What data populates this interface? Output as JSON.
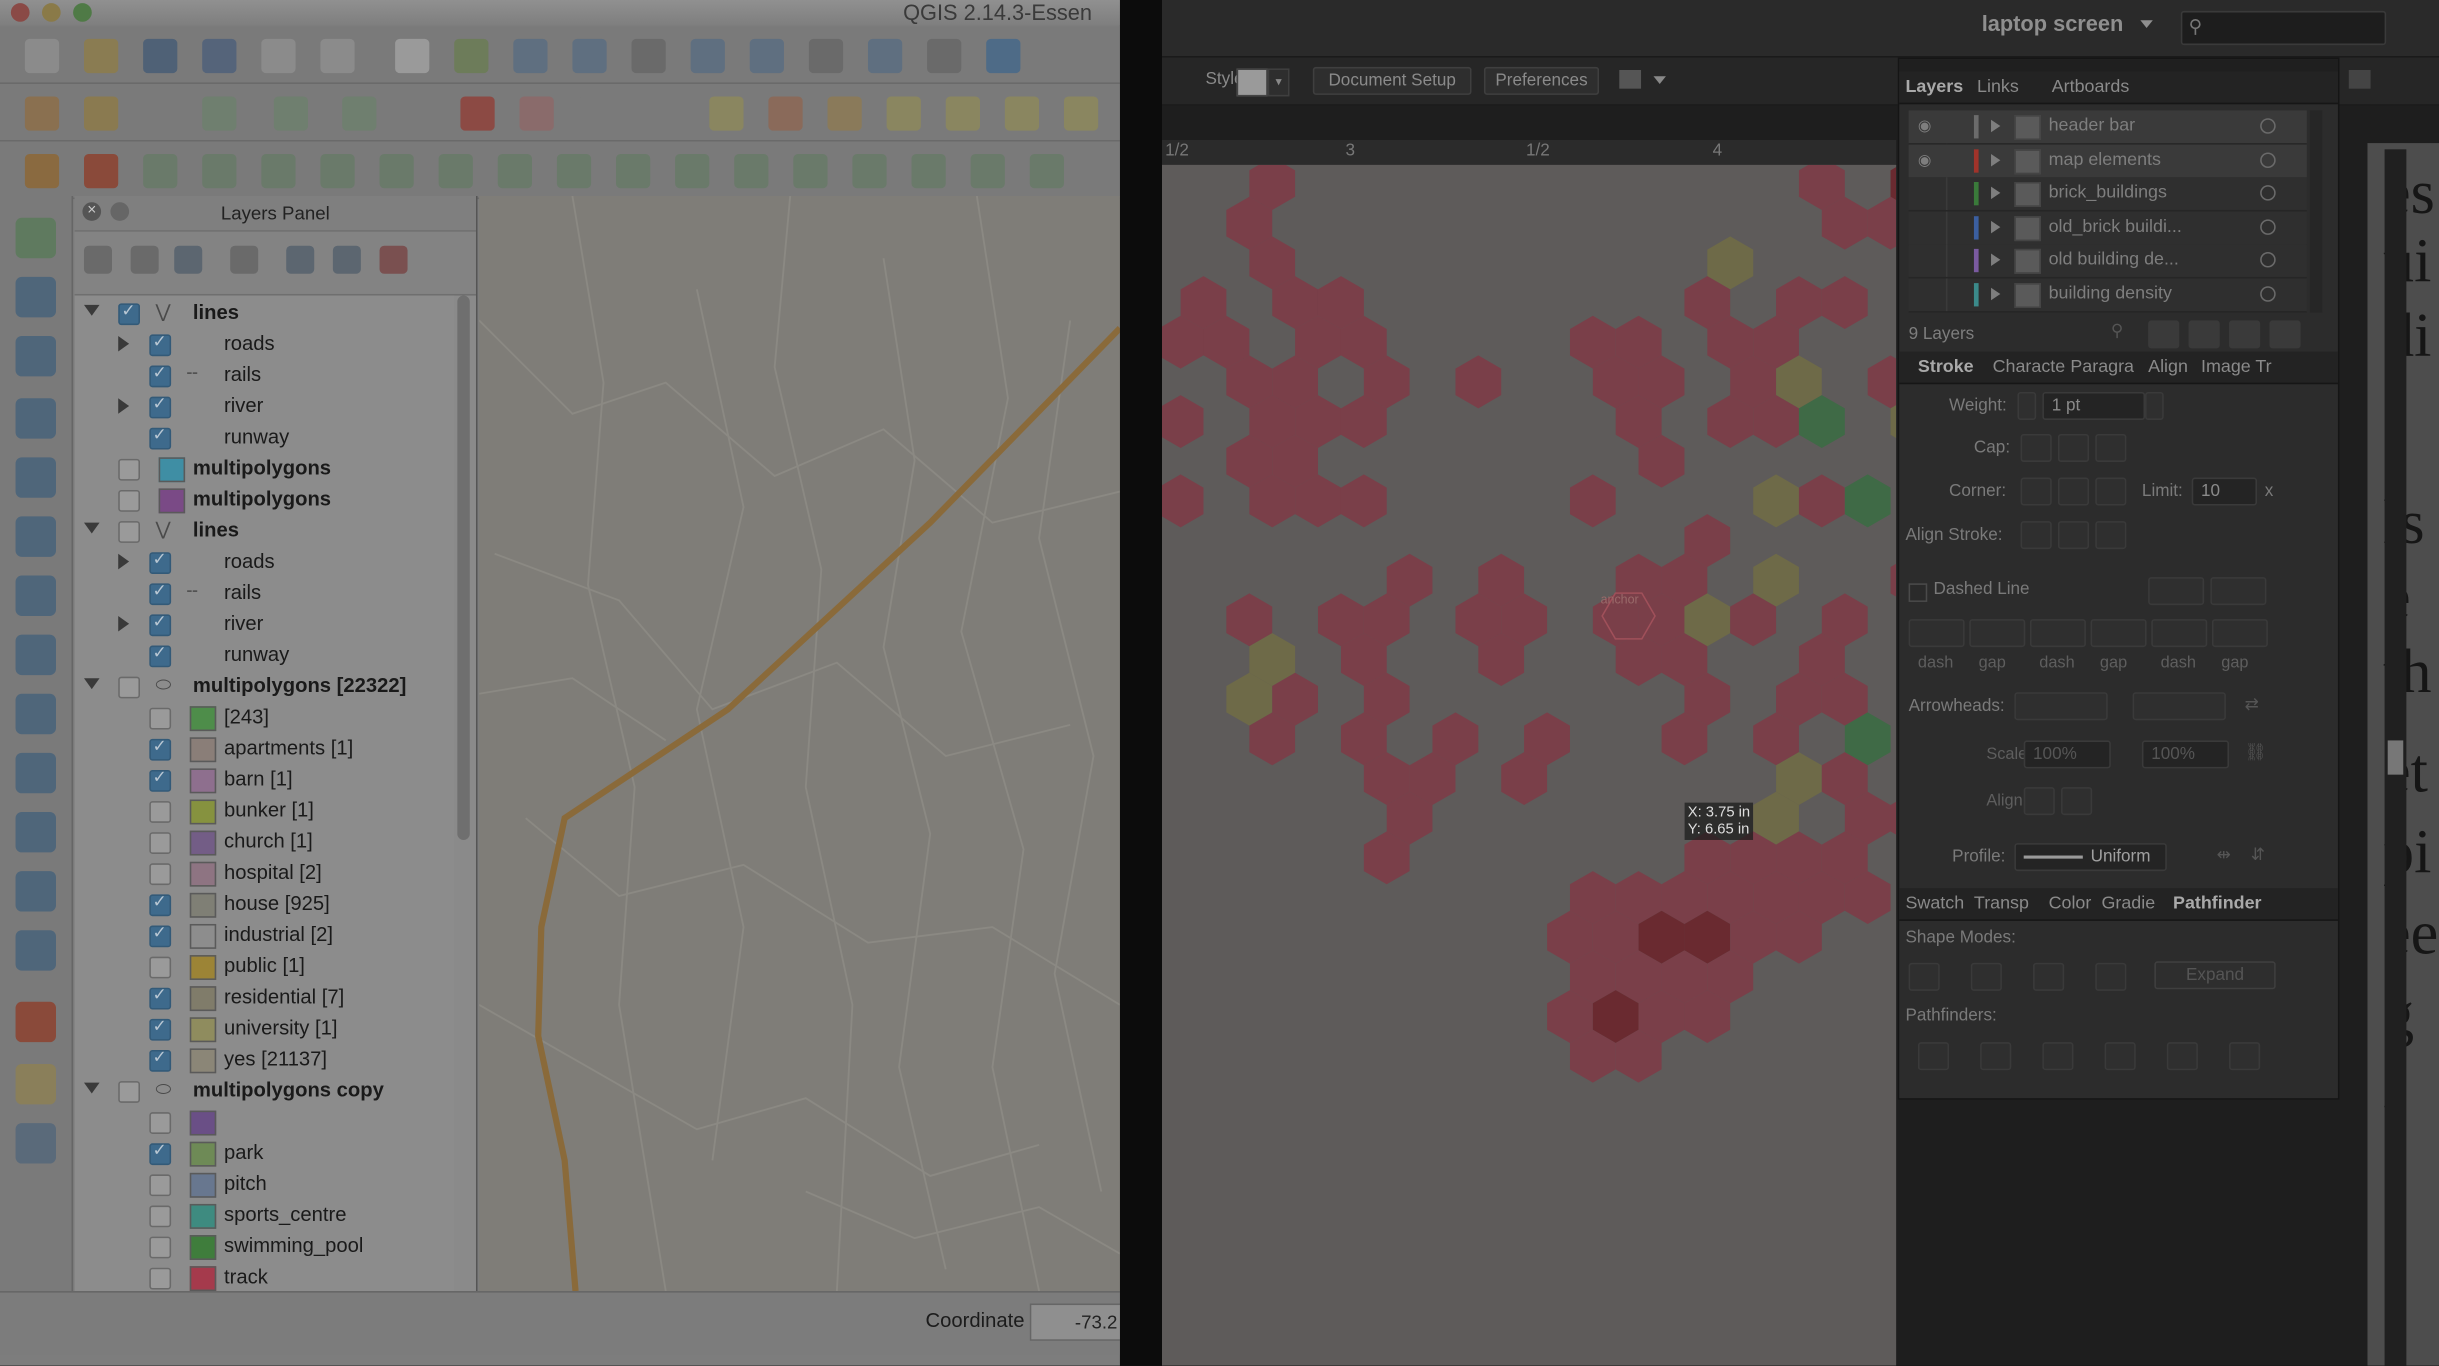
{
  "qgis": {
    "window_title": "QGIS 2.14.3-Essen",
    "layers_panel": {
      "title": "Layers Panel",
      "tree": [
        {
          "label": "lines",
          "bold": true,
          "checked": true,
          "expand": "down",
          "level": 0,
          "icon": "vector-line-icon"
        },
        {
          "label": "roads",
          "checked": true,
          "expand": "right",
          "level": 1
        },
        {
          "label": "rails",
          "checked": true,
          "level": 1,
          "icon": "dash-line-icon"
        },
        {
          "label": "river",
          "checked": true,
          "expand": "right",
          "level": 1
        },
        {
          "label": "runway",
          "checked": true,
          "level": 1
        },
        {
          "label": "multipolygons",
          "bold": true,
          "checked": false,
          "level": 0,
          "swatch": "#3f8ea4"
        },
        {
          "label": "multipolygons",
          "bold": true,
          "checked": false,
          "level": 0,
          "swatch": "#7a4a86"
        },
        {
          "label": "lines",
          "bold": true,
          "checked": false,
          "expand": "down",
          "level": 0,
          "icon": "vector-line-icon"
        },
        {
          "label": "roads",
          "checked": true,
          "expand": "right",
          "level": 1
        },
        {
          "label": "rails",
          "checked": true,
          "level": 1,
          "icon": "dash-line-icon"
        },
        {
          "label": "river",
          "checked": true,
          "expand": "right",
          "level": 1
        },
        {
          "label": "runway",
          "checked": true,
          "level": 1
        },
        {
          "label": "multipolygons [22322]",
          "bold": true,
          "checked": false,
          "expand": "down",
          "level": 0,
          "icon": "polygon-layer-icon"
        },
        {
          "label": "[243]",
          "checked": false,
          "level": 1,
          "swatch": "#4e8d4a"
        },
        {
          "label": "apartments [1]",
          "checked": true,
          "level": 1,
          "swatch": "#8a7e78"
        },
        {
          "label": "barn [1]",
          "checked": true,
          "level": 1,
          "swatch": "#8e6f8e"
        },
        {
          "label": "bunker [1]",
          "checked": false,
          "level": 1,
          "swatch": "#86923f"
        },
        {
          "label": "church [1]",
          "checked": false,
          "level": 1,
          "swatch": "#735d86"
        },
        {
          "label": "hospital [2]",
          "checked": false,
          "level": 1,
          "swatch": "#8e7482"
        },
        {
          "label": "house [925]",
          "checked": true,
          "level": 1,
          "swatch": "#7f7f75"
        },
        {
          "label": "industrial [2]",
          "checked": true,
          "level": 1,
          "swatch": "#8d8d8d"
        },
        {
          "label": "public [1]",
          "checked": false,
          "level": 1,
          "swatch": "#9c8436"
        },
        {
          "label": "residential [7]",
          "checked": true,
          "level": 1,
          "swatch": "#807c6a"
        },
        {
          "label": "university [1]",
          "checked": true,
          "level": 1,
          "swatch": "#8f8c5e"
        },
        {
          "label": "yes [21137]",
          "checked": true,
          "level": 1,
          "swatch": "#8b8677"
        },
        {
          "label": "multipolygons copy",
          "bold": true,
          "checked": false,
          "expand": "down",
          "level": 0,
          "icon": "polygon-layer-icon"
        },
        {
          "label": "",
          "checked": false,
          "level": 1,
          "swatch": "#6a4f86"
        },
        {
          "label": "park",
          "checked": true,
          "level": 1,
          "swatch": "#6e8a56"
        },
        {
          "label": "pitch",
          "checked": false,
          "level": 1,
          "swatch": "#68778f"
        },
        {
          "label": "sports_centre",
          "checked": false,
          "level": 1,
          "swatch": "#3e8b80"
        },
        {
          "label": "swimming_pool",
          "checked": false,
          "level": 1,
          "swatch": "#3f7d3c"
        },
        {
          "label": "track",
          "checked": false,
          "level": 1,
          "swatch": "#a53a4c"
        }
      ]
    },
    "status": {
      "coordinate_label": "Coordinate",
      "coordinate_value": "-73.2"
    }
  },
  "illustrator": {
    "workspace": "laptop screen",
    "control_bar": {
      "style_label": "Style:",
      "document_setup": "Document Setup",
      "preferences": "Preferences"
    },
    "ruler_ticks": [
      "1/2",
      "3",
      "1/2",
      "4"
    ],
    "doc_text_fragments": [
      "es",
      "ui",
      "di",
      "ls",
      "e s",
      "th",
      "et",
      "pi",
      "ee",
      "g i"
    ],
    "layers_panel": {
      "tabs": [
        "Layers",
        "Links",
        "Artboards"
      ],
      "layers": [
        {
          "name": "header bar",
          "visible": true,
          "color": "#6b6b6b"
        },
        {
          "name": "map elements",
          "visible": true,
          "color": "#a0332a"
        },
        {
          "name": "brick_buildings",
          "visible": false,
          "color": "#3a7a3a"
        },
        {
          "name": "old_brick buildi...",
          "visible": false,
          "color": "#3b5fa0"
        },
        {
          "name": "old building de...",
          "visible": false,
          "color": "#7a5aa0"
        },
        {
          "name": "building density",
          "visible": false,
          "color": "#3b8a8a"
        }
      ],
      "count": "9 Layers"
    },
    "stroke_panel": {
      "tabs": [
        "Stroke",
        "Characte",
        "Paragra",
        "Align",
        "Image Tr"
      ],
      "weight_label": "Weight:",
      "weight_value": "1 pt",
      "cap_label": "Cap:",
      "corner_label": "Corner:",
      "limit_label": "Limit:",
      "limit_value": "10",
      "limit_unit": "x",
      "align_label": "Align Stroke:",
      "dashed_label": "Dashed Line",
      "dash_labels": [
        "dash",
        "gap",
        "dash",
        "gap",
        "dash",
        "gap"
      ],
      "arrowheads_label": "Arrowheads:",
      "scale_label": "Scale:",
      "scale_value1": "100%",
      "scale_value2": "100%",
      "align2_label": "Align:",
      "profile_label": "Profile:",
      "profile_value": "Uniform"
    },
    "pathfinder_panel": {
      "tabs": [
        "Swatch",
        "Transp",
        "Color",
        "Gradie",
        "Pathfinder"
      ],
      "shape_modes_label": "Shape Modes:",
      "expand_label": "Expand",
      "pathfinders_label": "Pathfinders:"
    },
    "tooltip": {
      "x": "X: 3.75 in",
      "y": "Y: 6.65 in"
    },
    "anchor_label": "anchor"
  },
  "colors": {
    "hex_red": "#7a3f49",
    "hex_dark_red": "#6a2a30",
    "hex_yellow": "#6e6a48",
    "hex_green": "#3f6a46"
  }
}
